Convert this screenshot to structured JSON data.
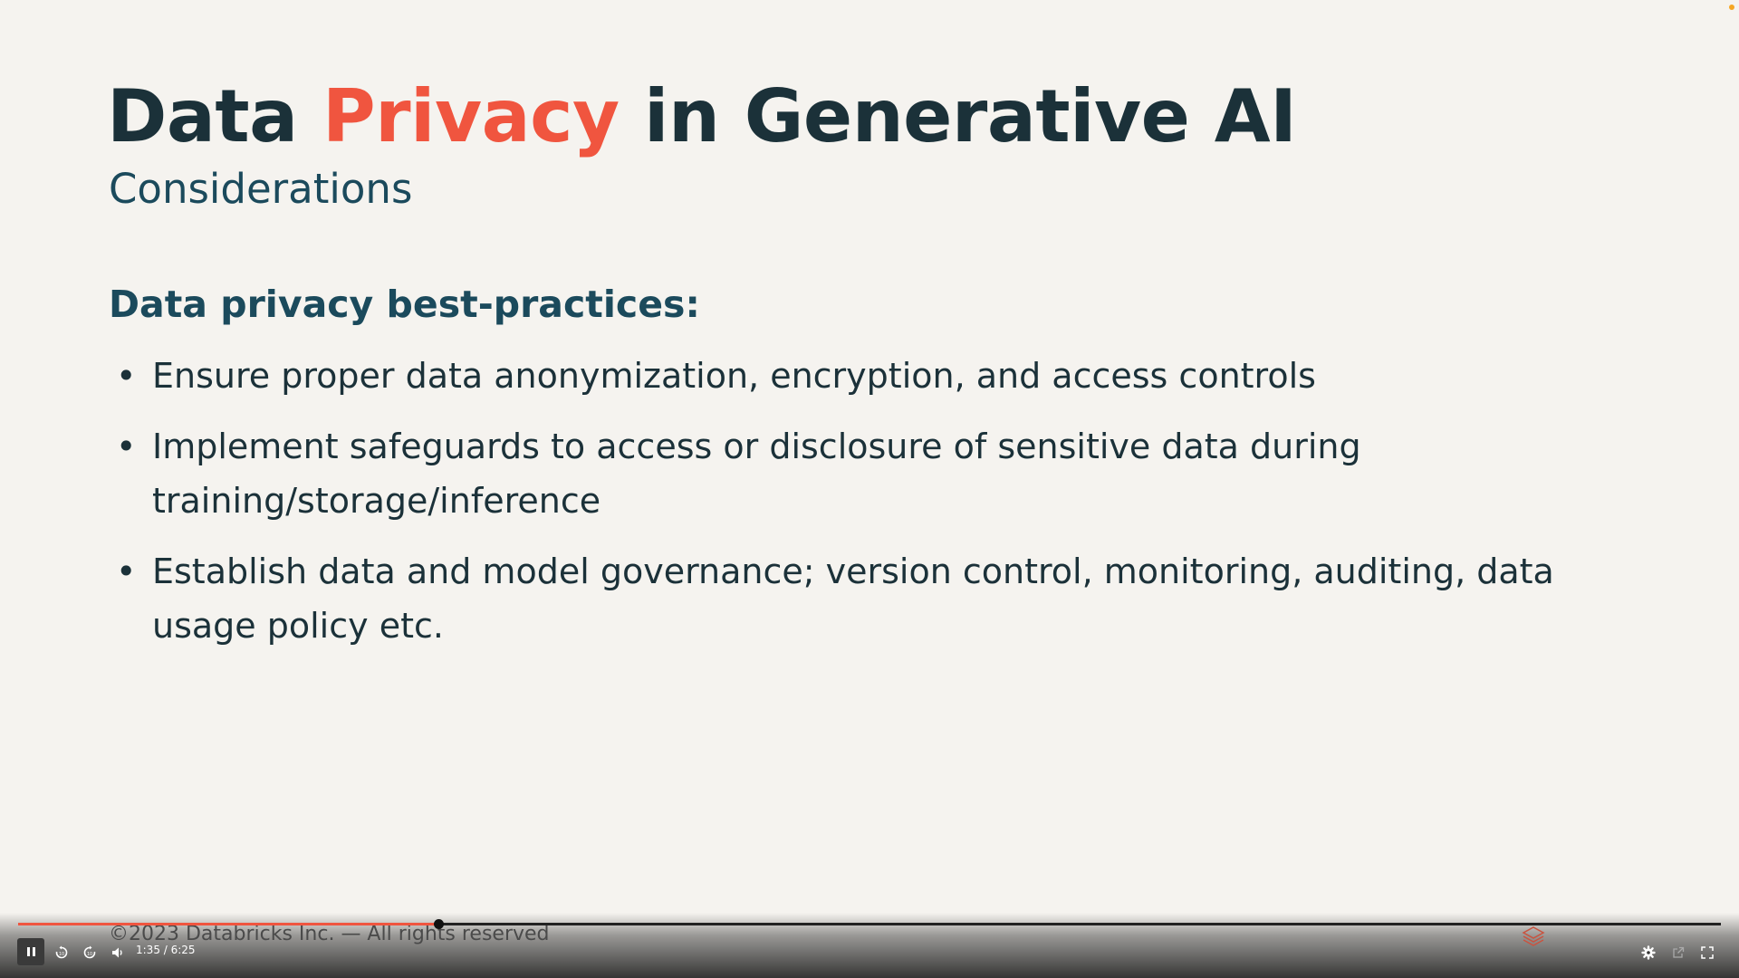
{
  "slide": {
    "title_part1": "Data ",
    "title_accent": "Privacy",
    "title_part2": " in Generative AI",
    "subtitle": "Considerations",
    "section_heading": "Data privacy best-practices:",
    "bullets": [
      "Ensure proper data anonymization, encryption, and access controls",
      "Implement safeguards to access or disclosure of sensitive data during training/storage/inference",
      "Establish data and model governance; version control, monitoring, auditing, data usage policy etc."
    ],
    "footer": "©2023 Databricks Inc. — All rights reserved"
  },
  "player": {
    "time": "1:35 / 6:25",
    "progress_fraction": 0.247,
    "icons": {
      "pause": "pause-icon",
      "rewind": "rewind-10-icon",
      "forward": "forward-10-icon",
      "volume": "volume-icon",
      "settings": "gear-icon",
      "popout": "popout-icon",
      "fullscreen": "fullscreen-icon",
      "logo": "databricks-logo-icon"
    }
  },
  "colors": {
    "background": "#f5f3ef",
    "title": "#1b3139",
    "accent": "#f0553f",
    "heading": "#1b4a5c"
  }
}
